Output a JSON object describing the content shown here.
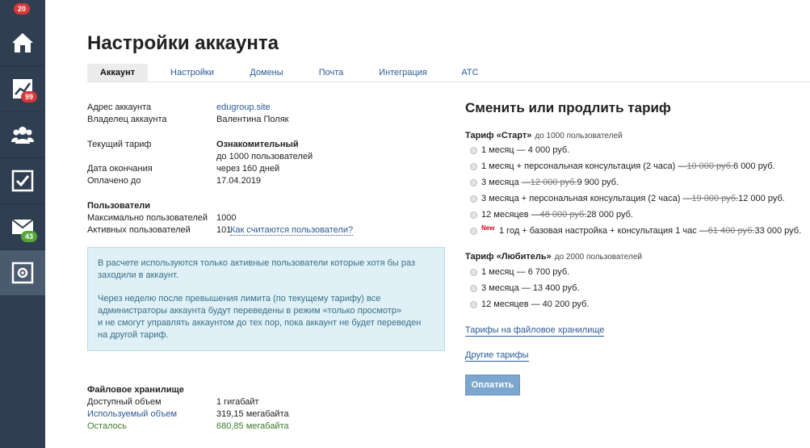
{
  "sidebar": {
    "top_badge": "20",
    "items": [
      {
        "icon": "home-icon"
      },
      {
        "icon": "chart-icon",
        "badge": "99",
        "badge_color": "#d33a3a"
      },
      {
        "icon": "users-icon"
      },
      {
        "icon": "tasks-icon"
      },
      {
        "icon": "mail-icon",
        "badge": "43",
        "badge_color": "#55a63a"
      },
      {
        "icon": "settings-icon"
      }
    ]
  },
  "page": {
    "title": "Настройки аккаунта"
  },
  "tabs": [
    {
      "label": "Аккаунт",
      "active": true
    },
    {
      "label": "Настройки",
      "active": false
    },
    {
      "label": "Домены",
      "active": false
    },
    {
      "label": "Почта",
      "active": false
    },
    {
      "label": "Интеграция",
      "active": false
    },
    {
      "label": "АТС",
      "active": false
    }
  ],
  "account": {
    "address_label": "Адрес аккаунта",
    "address_value": "edugroup.site",
    "owner_label": "Владелец аккаунта",
    "owner_value": "Валентина Поляк",
    "tariff_label": "Текущий тариф",
    "tariff_value": "Ознакомительный",
    "tariff_users": "до 1000 пользователей",
    "end_label": "Дата окончания",
    "end_value": "через 160 дней",
    "paid_label": "Оплачено до",
    "paid_value": "17.04.2019"
  },
  "users": {
    "heading": "Пользователи",
    "max_label": "Максимально пользователей",
    "max_value": "1000",
    "active_label": "Активных пользователей",
    "active_value": "101",
    "how_link": "Как считаются пользователи?"
  },
  "info": {
    "p1": "В расчете используются только активные пользователи которые хотя бы раз заходили в аккаунт.",
    "p2_l1": "Через неделю после превышения лимита (по текущему тарифу) все",
    "p2_l2": "администраторы аккаунта будут переведены в режим «только просмотр»",
    "p2_l3": "и не смогут управлять аккаунтом до тех пор, пока аккаунт не будет переведен",
    "p2_l4": "на другой тариф."
  },
  "storage": {
    "heading": "Файловое хранилище",
    "available_label": "Доступный объем",
    "available_value": "1 гигабайт",
    "used_label": "Используемый объем",
    "used_value": "319,15 мегабайта",
    "left_label": "Осталось",
    "left_value": "680,85 мегабайта",
    "used_color": "#2a5a96",
    "left_color": "#3d7a2a"
  },
  "change_tariff": {
    "title": "Сменить или продлить тариф",
    "start": {
      "name": "Тариф «Старт»",
      "sub": "до 1000 пользователей",
      "options": [
        {
          "text": "1 месяц — 4 000 руб.",
          "old": "",
          "price": ""
        },
        {
          "text": "1 месяц + персональная консультация (2 часа) — ",
          "old": "10 000 руб.",
          "price": " 6 000 руб."
        },
        {
          "text": "3 месяца — ",
          "old": "12 000 руб.",
          "price": " 9 900 руб."
        },
        {
          "text": "3 месяца + персональная консультация (2 часа) — ",
          "old": "19 000 руб.",
          "price": " 12 000 руб."
        },
        {
          "text": "12 месяцев — ",
          "old": "48 000 руб.",
          "price": " 28 000 руб."
        },
        {
          "text": "1 год + базовая настройка + консультация 1 час — ",
          "old": "61 400 руб.",
          "price": " 33 000 руб."
        }
      ],
      "new_label": "New"
    },
    "amateur": {
      "name": "Тариф «Любитель»",
      "sub": "до 2000 пользователей",
      "options": [
        {
          "text": "1 месяц — 6 700 руб."
        },
        {
          "text": "3 месяца — 13 400 руб."
        },
        {
          "text": "12 месяцев — 40 200 руб."
        }
      ]
    },
    "storage_link": "Тарифы на файловое хранилище",
    "other_link": "Другие тарифы",
    "pay_button": "Оплатить"
  }
}
